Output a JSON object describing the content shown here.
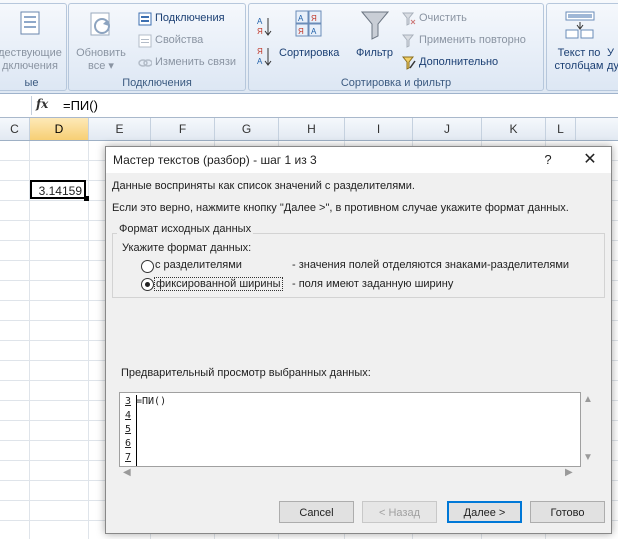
{
  "ribbon": {
    "groups": [
      {
        "label": "ые"
      },
      {
        "label": "Подключения"
      },
      {
        "label": "Сортировка и фильтр"
      },
      {
        "label": ""
      }
    ],
    "existing_conn_line1": "дествующие",
    "existing_conn_line2": "дключения",
    "refresh_line1": "Обновить",
    "refresh_line2": "все",
    "connections": "Подключения",
    "properties": "Свойства",
    "edit_links": "Изменить связи",
    "sort": "Сортировка",
    "filter": "Фильтр",
    "clear": "Очистить",
    "reapply": "Применить повторно",
    "advanced": "Дополнительно",
    "text_to_cols_line1": "Текст по",
    "text_to_cols_line2": "столбцам",
    "remove_dup_line2": "ду"
  },
  "formula_bar": {
    "fx": "fx",
    "formula": "=ПИ()"
  },
  "columns": [
    "C",
    "D",
    "E",
    "F",
    "G",
    "H",
    "I",
    "J",
    "K",
    "L"
  ],
  "selected_column": "D",
  "cell": {
    "value": "3.14159"
  },
  "dialog": {
    "title": "Мастер текстов (разбор) - шаг 1 из 3",
    "help": "?",
    "close": "✕",
    "line1": "Данные восприняты как список значений с разделителями.",
    "line2": "Если это верно, нажмите кнопку \"Далее >\", в противном случае укажите формат данных.",
    "frame_label": "Формат исходных данных",
    "prompt": "Укажите формат данных:",
    "options": [
      {
        "label": "с разделителями",
        "desc": "- значения полей отделяются знаками-разделителями",
        "checked": false
      },
      {
        "label": "фиксированной ширины",
        "desc": "- поля имеют заданную ширину",
        "checked": true
      }
    ],
    "preview_label": "Предварительный просмотр выбранных данных:",
    "preview_lines": [
      "3",
      "4",
      "5",
      "6",
      "7"
    ],
    "preview_text": "=ПИ()",
    "buttons": {
      "cancel": "Cancel",
      "back": "< Назад",
      "next": "Далее >",
      "finish": "Готово"
    }
  }
}
